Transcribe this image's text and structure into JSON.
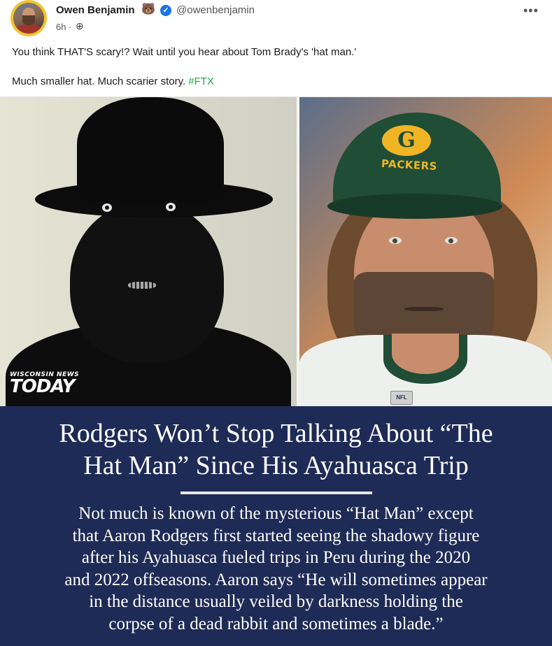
{
  "post": {
    "author_name": "Owen Benjamin",
    "author_emoji": "🐻",
    "handle": "@owenbenjamin",
    "time": "6h ·",
    "line1": "You think THAT'S scary!? Wait until you hear about Tom Brady's 'hat man.'",
    "line2_text": "Much smaller hat. Much scarier story. ",
    "hashtag": "#FTX",
    "more_icon": "•••",
    "globe_glyph": "⊕",
    "verified_glyph": "✓"
  },
  "image": {
    "watermark_small": "WISCONSIN NEWS",
    "watermark_big": "TODAY",
    "cap_text": "PACKERS",
    "nfl_badge": "NFL",
    "headline_line1": "Rodgers Won’t Stop Talking About “The",
    "headline_line2": "Hat Man” Since His Ayahuasca Trip",
    "body_lines": [
      "Not much is known of the mysterious “Hat Man” except",
      "that Aaron Rodgers first started seeing the shadowy figure",
      "after his Ayahuasca fueled trips in Peru during the 2020",
      "and 2022 offseasons. Aaron says “He will sometimes appear",
      "in the distance usually veiled by darkness holding the",
      "corpse of a dead rabbit and sometimes a blade.”"
    ]
  },
  "colors": {
    "accent_hashtag": "#1fa84a",
    "verified_blue": "#1a73e8",
    "banner_navy": "#1e2b56"
  }
}
